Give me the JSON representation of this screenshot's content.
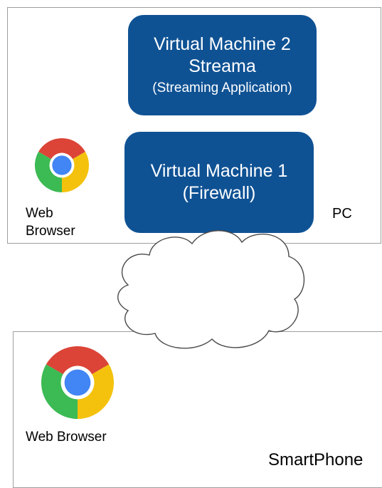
{
  "pc": {
    "label": "PC",
    "browser_label": "Web Browser"
  },
  "vm2": {
    "line1": "Virtual Machine 2",
    "line2": "Streama",
    "line3": "(Streaming Application)"
  },
  "vm1": {
    "line1": "Virtual Machine 1",
    "line2": "(Firewall)"
  },
  "smartphone": {
    "label": "SmartPhone",
    "browser_label": "Web Browser"
  },
  "colors": {
    "vm_fill": "#0f5294",
    "chrome_red": "#db4437",
    "chrome_yellow": "#f4c20d",
    "chrome_green": "#3cba54",
    "chrome_blue": "#4285f4"
  }
}
